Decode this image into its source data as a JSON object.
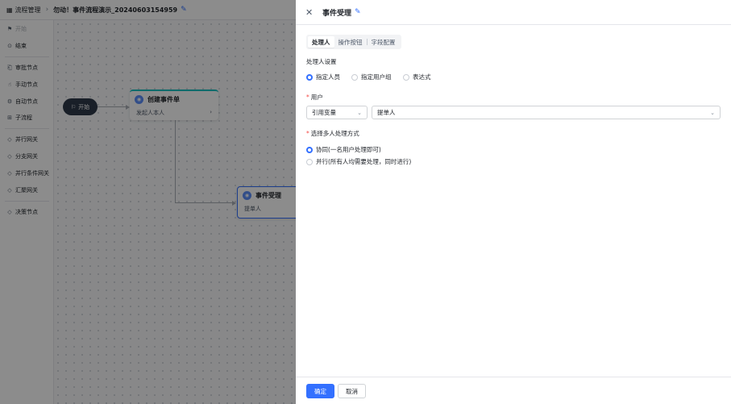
{
  "topbar": {
    "menu_label": "流程管理",
    "flow_title": "勿动！事件流程演示_20240603154959"
  },
  "palette": {
    "items": [
      "开始",
      "结束",
      "审批节点",
      "手动节点",
      "自动节点",
      "子流程",
      "并行网关",
      "分支网关",
      "并行条件网关",
      "汇聚网关",
      "决策节点"
    ]
  },
  "canvas": {
    "start_label": "开始",
    "node1": {
      "title": "创建事件单",
      "subtitle": "发起人本人"
    },
    "node2": {
      "title": "事件受理",
      "subtitle": "提单人"
    }
  },
  "drawer": {
    "title": "事件受理",
    "tabs": [
      "处理人",
      "操作按钮",
      "字段配置"
    ],
    "handler_section_label": "处理人设置",
    "handler_options": [
      "指定人员",
      "指定用户组",
      "表达式"
    ],
    "user_label": "用户",
    "var_select": "引用变量",
    "user_select": "提单人",
    "multi_label": "选择多人处理方式",
    "multi_options": [
      "协同(一名用户处理即可)",
      "并行(所有人均需要处理，同时进行)"
    ],
    "confirm_label": "确定",
    "cancel_label": "取消"
  },
  "colors": {
    "accent": "#3370ff",
    "required": "#f54a45",
    "start_node": "#2f3a4a",
    "node1_top": "#15c4c4"
  }
}
